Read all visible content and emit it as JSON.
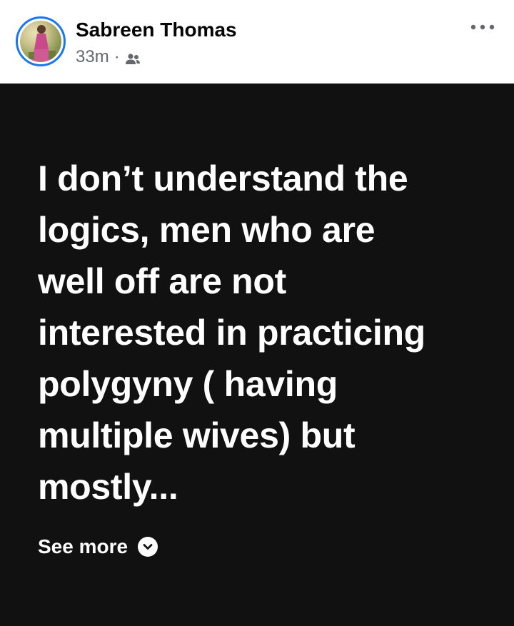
{
  "post": {
    "author": "Sabreen Thomas",
    "time": "33m",
    "separator": "·",
    "audience_icon": "friends-icon",
    "more_icon": "more-options-icon",
    "lines": [
      "I don’t understand the",
      "logics, men who are",
      "well off are not",
      "interested in practicing",
      "polygyny ( having",
      "multiple wives) but",
      "mostly..."
    ],
    "see_more_label": "See more",
    "see_more_icon": "chevron-down-icon"
  },
  "colors": {
    "accent": "#1877f2",
    "background_post": "#111111",
    "text_primary": "#050505",
    "text_secondary": "#65676b"
  }
}
